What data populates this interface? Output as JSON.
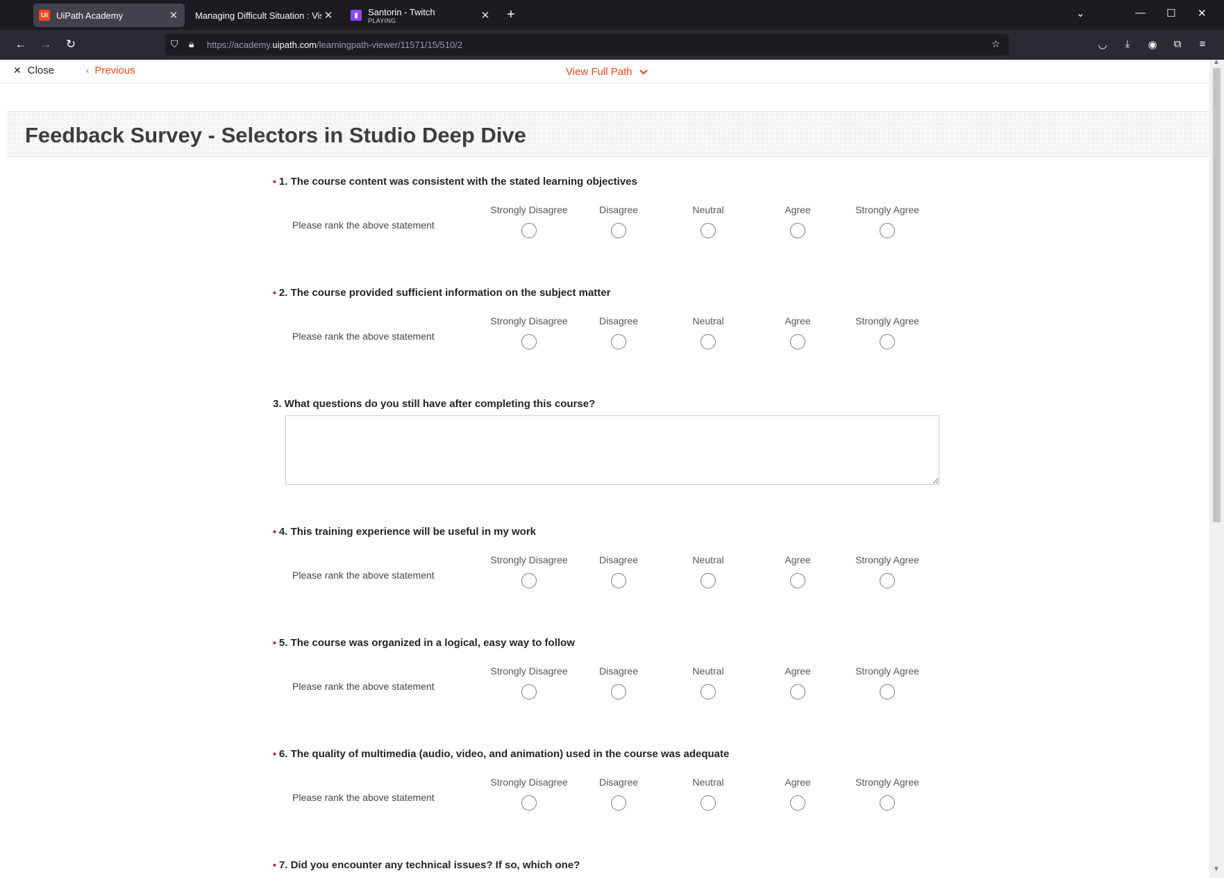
{
  "browser": {
    "tabs": [
      {
        "title": "UiPath Academy",
        "icon": "uipath-logo-icon",
        "active": true
      },
      {
        "title": "Managing Difficult Situation : Visual",
        "icon": "",
        "active": false
      },
      {
        "title": "Santorin - Twitch",
        "subtitle": "PLAYING",
        "icon": "twitch-icon",
        "active": false
      }
    ],
    "url_prefix": "https://academy.",
    "url_host": "uipath.com",
    "url_path": "/learningpath-viewer/11571/15/510/2"
  },
  "nav": {
    "close_label": "Close",
    "previous_label": "Previous",
    "view_full_path_label": "View Full Path"
  },
  "survey": {
    "title": "Feedback Survey - Selectors in Studio Deep Dive",
    "scale_options": [
      "Strongly Disagree",
      "Disagree",
      "Neutral",
      "Agree",
      "Strongly Agree"
    ],
    "row_label": "Please rank the above statement",
    "questions": [
      {
        "text": "1. The course content was consistent with the stated learning objectives",
        "required": true,
        "type": "scale"
      },
      {
        "text": "2. The course provided sufficient information on the subject matter",
        "required": true,
        "type": "scale"
      },
      {
        "text": "3. What questions do you still have after completing this course?",
        "required": false,
        "type": "text",
        "value": ""
      },
      {
        "text": "4. This training experience will be useful in my work",
        "required": true,
        "type": "scale"
      },
      {
        "text": "5. The course was organized in a logical, easy way to follow",
        "required": true,
        "type": "scale"
      },
      {
        "text": "6. The quality of multimedia (audio, video, and animation) used in the course was adequate",
        "required": true,
        "type": "scale"
      },
      {
        "text": "7. Did you encounter any technical issues? If so, which one?",
        "required": true,
        "type": "text"
      }
    ]
  },
  "colors": {
    "accent": "#fa4616",
    "required": "#e0001b",
    "chrome_dark": "#1c1b22",
    "chrome_toolbar": "#2b2a33"
  }
}
